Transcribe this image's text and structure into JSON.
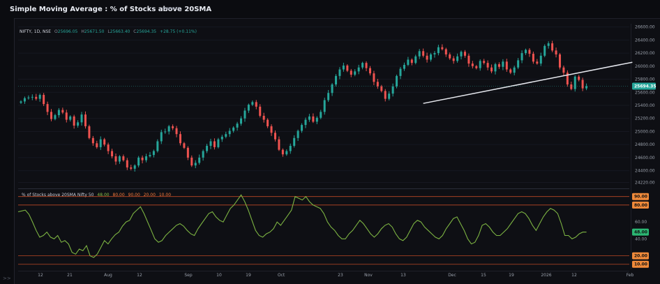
{
  "header": {
    "title": "Simple Moving Average : % of Stocks above 20SMA",
    "tag": "KANAK TV"
  },
  "price_legend": {
    "symbol": "NIFTY, 1D, NSE",
    "items": [
      {
        "label": "O",
        "value": "25696.05"
      },
      {
        "label": "H",
        "value": "25671.50"
      },
      {
        "label": "L",
        "value": "25663.40"
      },
      {
        "label": "C",
        "value": "25694.35"
      },
      {
        "label": "",
        "value": "+28.75 (+0.11%)"
      }
    ]
  },
  "indicator_legend": {
    "name": "% of Stocks above 20SMA Nifty 50",
    "items": [
      {
        "value": "48.00",
        "color": "#8bc34a"
      },
      {
        "value": "80.00",
        "color": "#f5793b"
      },
      {
        "value": "90.00",
        "color": "#f5793b"
      },
      {
        "value": "20.00",
        "color": "#f5793b"
      },
      {
        "value": "10.00",
        "color": "#f5793b"
      }
    ]
  },
  "colors": {
    "up": "#26a69a",
    "down": "#ef5350",
    "trendline": "#e6e8ee",
    "indicator": "#7cb342",
    "levels": "#e8572a"
  },
  "left_icon": ">>",
  "chart_data": [
    {
      "type": "candlestick",
      "ylim": [
        24150,
        26650
      ],
      "y_ticks": [
        "26600.00",
        "26400.00",
        "26200.00",
        "26000.00",
        "25800.00",
        "25600.00",
        "25400.00",
        "25200.00",
        "25000.00",
        "24800.00",
        "24600.00",
        "24400.00",
        "24220.00"
      ],
      "y_tick_values": [
        26600,
        26400,
        26200,
        26000,
        25800,
        25600,
        25400,
        25200,
        25000,
        24800,
        24600,
        24400,
        24220
      ],
      "last_price_label": "25694.35",
      "last_price": 25694.35,
      "closes": [
        25460,
        25510,
        25520,
        25530,
        25500,
        25560,
        25420,
        25300,
        25190,
        25250,
        25330,
        25290,
        25180,
        25230,
        25090,
        25140,
        25260,
        25080,
        24900,
        24820,
        24760,
        24880,
        24800,
        24700,
        24620,
        24540,
        24620,
        24560,
        24450,
        24430,
        24480,
        24600,
        24560,
        24620,
        24640,
        24700,
        24850,
        24990,
        25000,
        25080,
        25050,
        24960,
        24820,
        24750,
        24600,
        24480,
        24520,
        24600,
        24700,
        24780,
        24850,
        24760,
        24880,
        24920,
        24960,
        25010,
        25060,
        25120,
        25200,
        25320,
        25410,
        25450,
        25380,
        25240,
        25180,
        25080,
        24980,
        24880,
        24720,
        24650,
        24700,
        24780,
        24900,
        25010,
        25100,
        25180,
        25230,
        25150,
        25210,
        25300,
        25480,
        25590,
        25720,
        25850,
        25950,
        26010,
        25930,
        25870,
        25920,
        25980,
        26050,
        25970,
        25890,
        25760,
        25690,
        25620,
        25500,
        25580,
        25690,
        25850,
        25960,
        26020,
        26100,
        26050,
        26150,
        26230,
        26160,
        26100,
        26180,
        26200,
        26290,
        26260,
        26180,
        26120,
        26080,
        26150,
        26220,
        26160,
        26040,
        26000,
        25970,
        26080,
        26050,
        25980,
        25920,
        26030,
        25990,
        26070,
        25950,
        25900,
        25980,
        26090,
        26200,
        26250,
        26190,
        26070,
        26040,
        26160,
        26310,
        26350,
        26240,
        26180,
        25980,
        25900,
        25720,
        25650,
        25840,
        25790,
        25660,
        25694
      ],
      "trendline": {
        "start_index": 106,
        "start_value": 25430,
        "end_index": 160,
        "end_value": 26060
      },
      "x_ticks": [
        "12",
        "21",
        "Aug",
        "12",
        "Sep",
        "10",
        "19",
        "Oct",
        "23",
        "Nov",
        "13",
        "Dec",
        "15",
        "19",
        "2026",
        "12",
        "Feb"
      ]
    },
    {
      "type": "line",
      "name": "% of Stocks above 20SMA Nifty 50",
      "ylim": [
        4,
        98
      ],
      "y_ticks": [
        "90.00",
        "80.00",
        "60.00",
        "48.00",
        "40.00",
        "20.00",
        "10.00"
      ],
      "y_tick_values": [
        90,
        80,
        60,
        48,
        40,
        20,
        10
      ],
      "badges": [
        "90.00",
        "80.00",
        "48.00",
        "20.00",
        "10.00"
      ],
      "levels": [
        90,
        80,
        20,
        10
      ],
      "values": [
        72,
        73,
        74,
        69,
        60,
        50,
        42,
        44,
        48,
        42,
        40,
        44,
        36,
        38,
        34,
        24,
        22,
        28,
        26,
        32,
        20,
        18,
        22,
        30,
        38,
        34,
        40,
        45,
        48,
        55,
        60,
        62,
        70,
        74,
        78,
        70,
        60,
        50,
        40,
        36,
        38,
        44,
        48,
        52,
        56,
        58,
        55,
        50,
        46,
        44,
        52,
        58,
        64,
        70,
        72,
        66,
        62,
        60,
        68,
        76,
        80,
        86,
        92,
        84,
        74,
        62,
        50,
        44,
        42,
        46,
        48,
        52,
        60,
        56,
        62,
        68,
        74,
        90,
        88,
        86,
        90,
        84,
        80,
        78,
        76,
        70,
        60,
        54,
        50,
        44,
        40,
        40,
        46,
        50,
        56,
        62,
        58,
        52,
        46,
        42,
        46,
        52,
        56,
        58,
        54,
        46,
        40,
        38,
        42,
        50,
        58,
        62,
        60,
        54,
        50,
        46,
        42,
        40,
        44,
        52,
        58,
        64,
        66,
        58,
        50,
        40,
        34,
        36,
        44,
        56,
        58,
        54,
        48,
        44,
        44,
        48,
        52,
        58,
        64,
        70,
        72,
        70,
        64,
        56,
        50,
        58,
        66,
        72,
        76,
        74,
        70,
        58,
        44,
        44,
        40,
        42,
        46,
        48,
        48
      ]
    }
  ]
}
